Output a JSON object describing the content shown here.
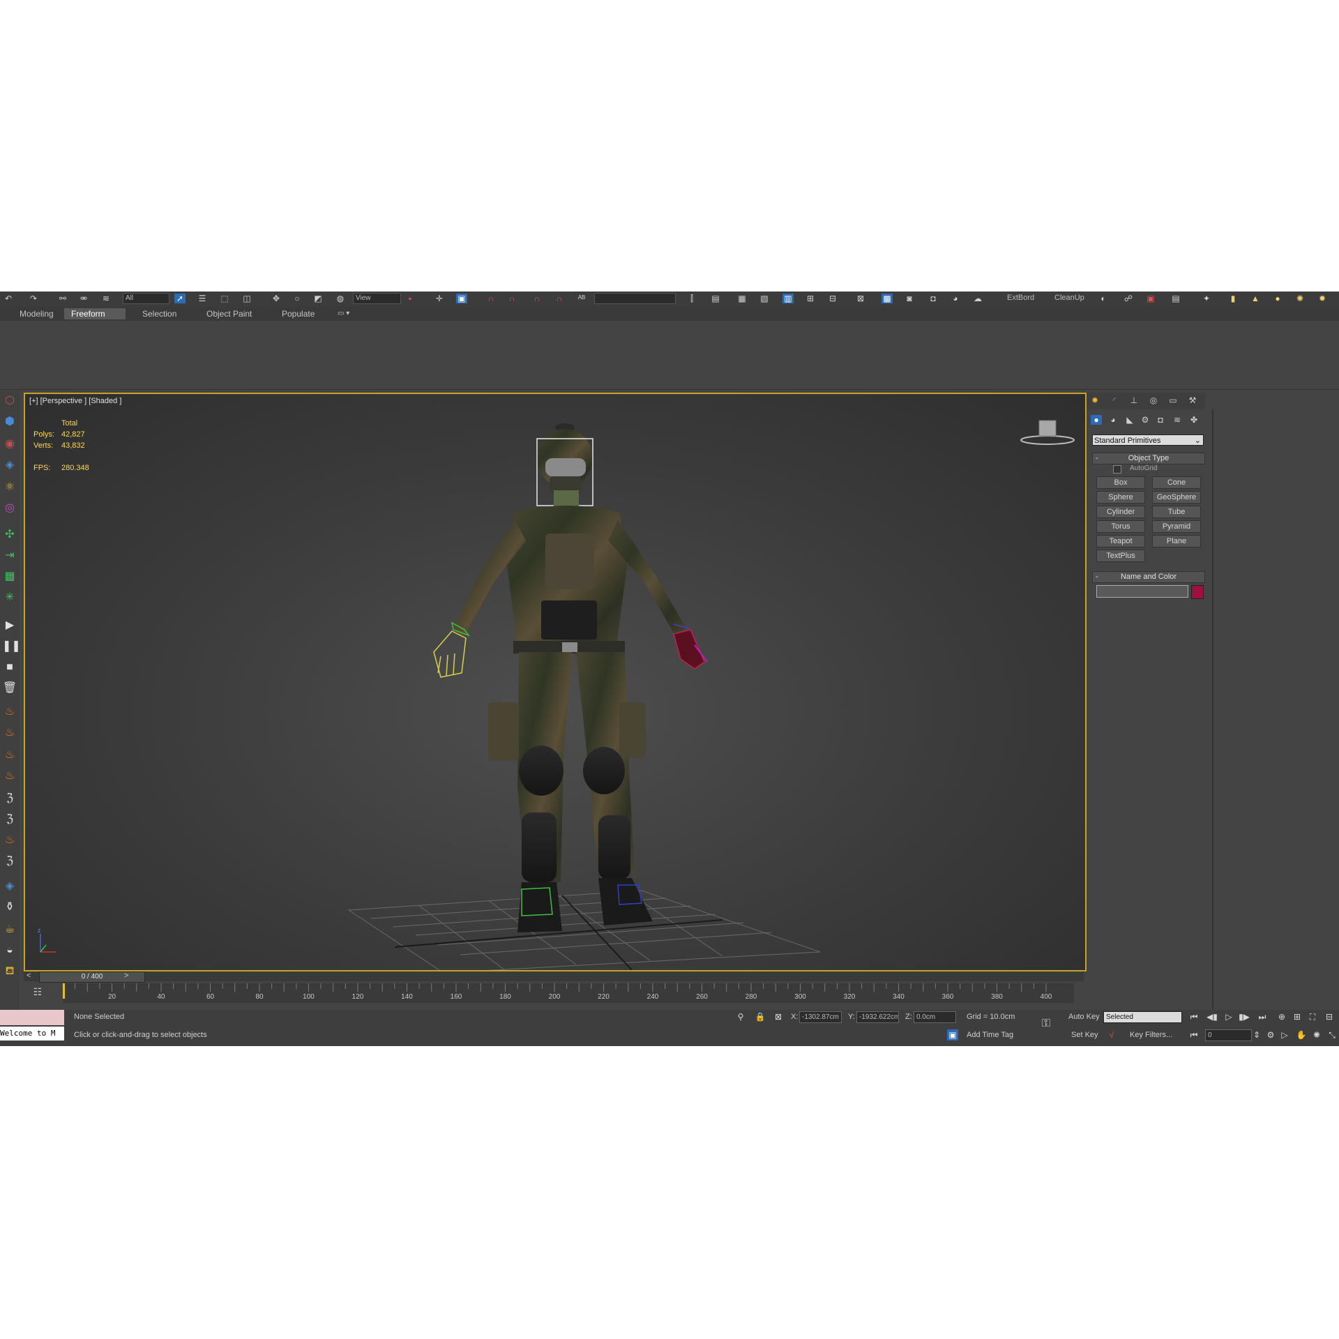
{
  "toolbar": {
    "selection_filter": "All",
    "view_dropdown": "View",
    "named_selection": "",
    "extras": [
      "ExtBord",
      "CleanUp"
    ]
  },
  "ribbon": {
    "tabs": [
      {
        "label": "Modeling",
        "active": false
      },
      {
        "label": "Freeform",
        "active": true
      },
      {
        "label": "Selection",
        "active": false
      },
      {
        "label": "Object Paint",
        "active": false
      },
      {
        "label": "Populate",
        "active": false
      }
    ]
  },
  "viewport": {
    "label": "[+] [Perspective ] [Shaded ]",
    "stats": {
      "total_label": "Total",
      "polys_label": "Polys:",
      "polys_value": "42,827",
      "verts_label": "Verts:",
      "verts_value": "43,832",
      "fps_label": "FPS:",
      "fps_value": "280.348"
    },
    "axis": {
      "z": "z"
    }
  },
  "timeline": {
    "counter": "0 / 400",
    "prev": "<",
    "next": ">",
    "current_frame": 0,
    "total_frames": 400,
    "ticks": [
      "20",
      "40",
      "60",
      "80",
      "100",
      "120",
      "140",
      "160",
      "180",
      "200",
      "220",
      "240",
      "260",
      "280",
      "300",
      "320",
      "340",
      "360",
      "380",
      "400"
    ]
  },
  "command_panel": {
    "category": "Standard Primitives",
    "object_type_header": "Object Type",
    "autogrid_label": "AutoGrid",
    "buttons": [
      "Box",
      "Cone",
      "Sphere",
      "GeoSphere",
      "Cylinder",
      "Tube",
      "Torus",
      "Pyramid",
      "Teapot",
      "Plane",
      "TextPlus"
    ],
    "name_color_header": "Name and Color",
    "name_value": "",
    "color": "#9e1040"
  },
  "status": {
    "maxscript": "Welcome to M",
    "selection": "None Selected",
    "prompt": "Click or click-and-drag to select objects",
    "x_label": "X:",
    "x_value": "-1302.87cm",
    "y_label": "Y:",
    "y_value": "-1932.622cm",
    "z_label": "Z:",
    "z_value": "0.0cm",
    "grid": "Grid = 10.0cm",
    "add_time_tag": "Add Time Tag",
    "auto_key": "Auto Key",
    "set_key": "Set Key",
    "key_mode": "Selected",
    "key_filters": "Key Filters...",
    "frame": "0"
  },
  "colors": {
    "viewport_border": "#c9a227",
    "stats_text": "#ffd65a",
    "ui_bg": "#444444"
  }
}
